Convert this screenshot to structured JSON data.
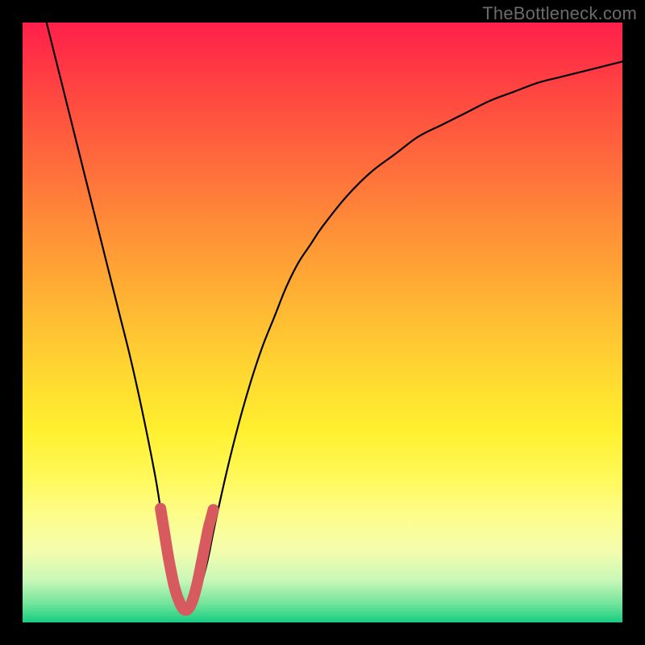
{
  "watermark": "TheBottleneck.com",
  "chart_data": {
    "type": "line",
    "title": "",
    "xlabel": "",
    "ylabel": "",
    "xlim": [
      0,
      100
    ],
    "ylim": [
      0,
      100
    ],
    "series": [
      {
        "name": "bottleneck-curve",
        "x": [
          4,
          6,
          8,
          10,
          12,
          14,
          16,
          18,
          20,
          22,
          23,
          24,
          25,
          26,
          27,
          28,
          29,
          30,
          31,
          32,
          34,
          36,
          38,
          40,
          42,
          44,
          46,
          48,
          50,
          54,
          58,
          62,
          66,
          70,
          74,
          78,
          82,
          86,
          90,
          94,
          98,
          100
        ],
        "y": [
          100,
          92,
          84,
          76,
          68,
          60,
          52,
          44,
          35,
          25,
          19,
          13,
          7,
          4,
          2,
          2,
          4,
          7,
          11,
          16,
          25,
          33,
          40,
          46,
          51,
          56,
          60,
          63,
          66,
          71,
          75,
          78,
          81,
          83,
          85,
          87,
          88.5,
          90,
          91,
          92,
          93,
          93.5
        ]
      },
      {
        "name": "optimum-marker",
        "x": [
          23.0,
          23.4,
          23.8,
          24.2,
          24.6,
          25.0,
          25.4,
          25.8,
          26.2,
          26.6,
          27.0,
          27.4,
          27.8,
          28.2,
          28.6,
          29.0,
          29.4,
          29.8,
          30.2,
          30.6,
          31.0,
          31.4,
          31.8
        ],
        "y": [
          19.0,
          16.5,
          14.0,
          11.5,
          9.3,
          7.3,
          5.6,
          4.3,
          3.3,
          2.5,
          2.1,
          2.1,
          2.5,
          3.3,
          4.5,
          6.0,
          7.8,
          9.8,
          11.8,
          13.8,
          15.8,
          17.3,
          18.8
        ]
      }
    ],
    "colors": {
      "curve": "#000000",
      "marker": "#d65a5e"
    }
  }
}
